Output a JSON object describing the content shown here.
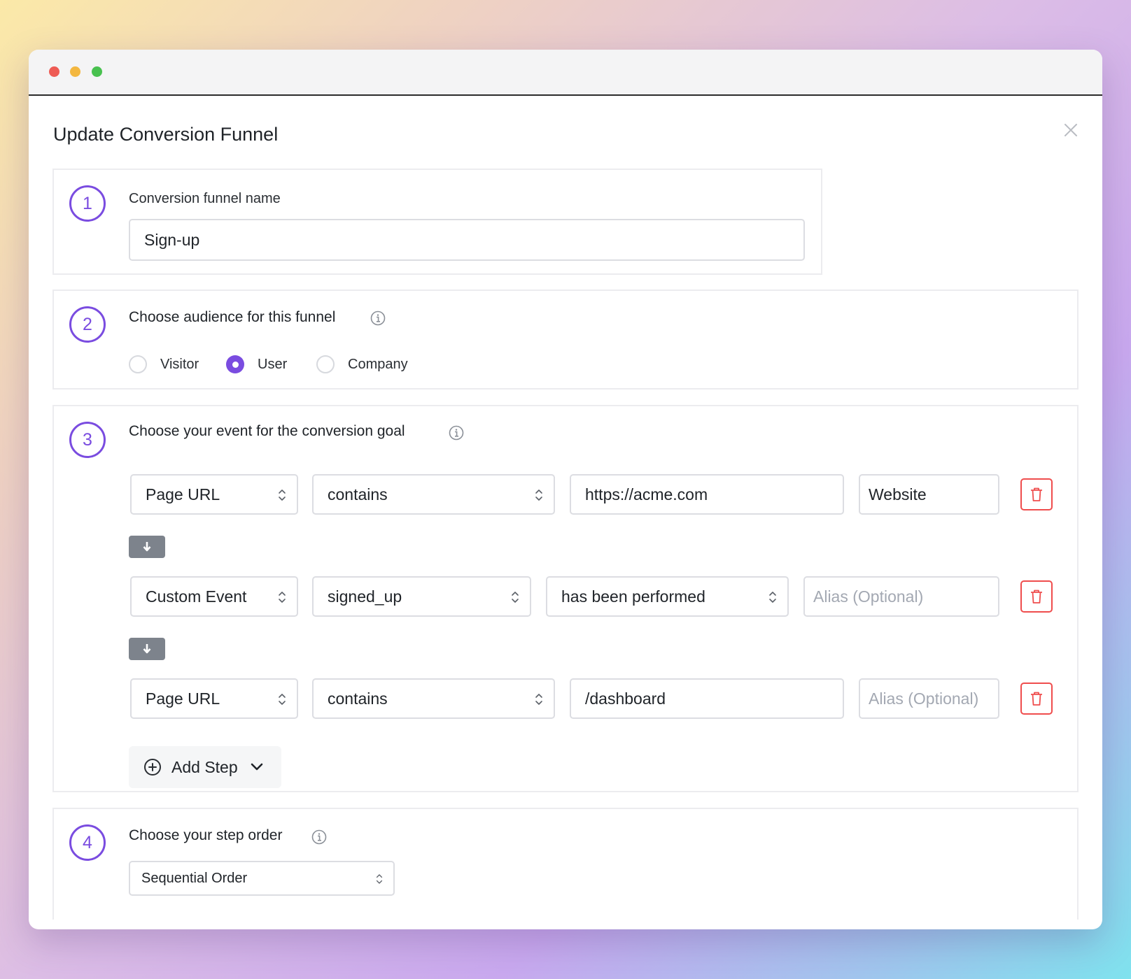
{
  "modal": {
    "title": "Update Conversion Funnel"
  },
  "step1": {
    "number": "1",
    "label": "Conversion funnel name",
    "name_value": "Sign-up"
  },
  "step2": {
    "number": "2",
    "label": "Choose audience for this funnel",
    "options": [
      "Visitor",
      "User",
      "Company"
    ],
    "selected": "User"
  },
  "step3": {
    "number": "3",
    "label": "Choose your event for the conversion goal",
    "rows": [
      {
        "type": "Page URL",
        "operator": "contains",
        "value": "https://acme.com",
        "alias": "Website",
        "alias_placeholder": "Alias (Optional)"
      },
      {
        "type": "Custom Event",
        "event": "signed_up",
        "condition": "has been performed",
        "alias": "",
        "alias_placeholder": "Alias (Optional)"
      },
      {
        "type": "Page URL",
        "operator": "contains",
        "value": "/dashboard",
        "alias": "",
        "alias_placeholder": "Alias (Optional)"
      }
    ],
    "add_step_label": "Add Step"
  },
  "step4": {
    "number": "4",
    "label": "Choose your step order",
    "order_value": "Sequential Order"
  },
  "colors": {
    "accent": "#7a4ce0",
    "danger": "#ef4d4d",
    "arrow_button": "#7d838c"
  },
  "icons": [
    "close-icon",
    "info-icon",
    "chevron-updown-icon",
    "arrow-down-icon",
    "trash-icon",
    "plus-circle-icon",
    "chevron-down-icon"
  ]
}
